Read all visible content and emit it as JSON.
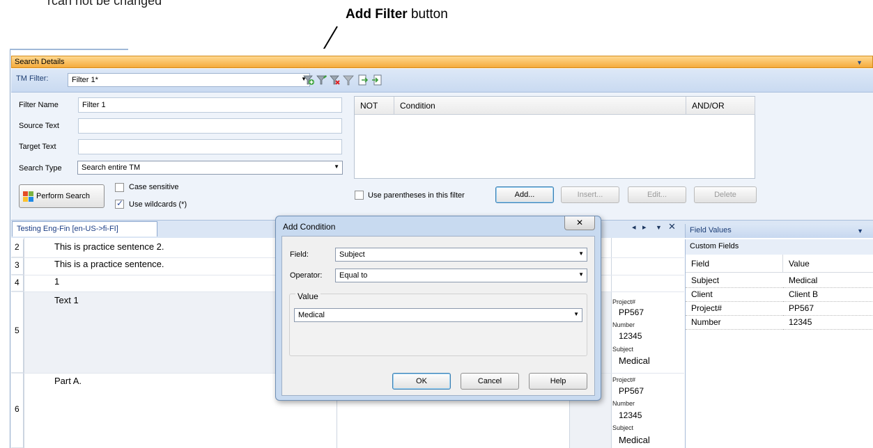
{
  "annotation": {
    "top_text": "rcan not be changed",
    "callout_bold": "Add Filter",
    "callout_rest": " button"
  },
  "app": {
    "panel_title": "Search Details",
    "tm_filter_label": "TM Filter:",
    "tm_filter_value": "Filter 1*",
    "toolbar_icons": [
      "add-filter-icon",
      "edit-filter-icon",
      "delete-filter-icon",
      "clear-filter-icon",
      "export-filter-icon",
      "import-filter-icon"
    ]
  },
  "form": {
    "filter_name_label": "Filter Name",
    "filter_name_value": "Filter 1",
    "source_text_label": "Source Text",
    "source_text_value": "",
    "target_text_label": "Target Text",
    "target_text_value": "",
    "search_type_label": "Search Type",
    "search_type_value": "Search entire TM",
    "perform_search": "Perform Search",
    "case_sensitive": "Case sensitive",
    "case_sensitive_checked": false,
    "use_wildcards": "Use wildcards (*)",
    "use_wildcards_checked": true
  },
  "conditions": {
    "col_not": "NOT",
    "col_condition": "Condition",
    "col_andor": "AND/OR",
    "use_parentheses": "Use parentheses in this filter",
    "add": "Add...",
    "insert": "Insert...",
    "edit": "Edit...",
    "delete": "Delete"
  },
  "doc": {
    "tab_label": "Testing Eng-Fin [en-US->fi-FI]",
    "rows": [
      {
        "num": "2",
        "text": "This is practice sentence 2."
      },
      {
        "num": "3",
        "text": "This is a practice sentence."
      },
      {
        "num": "4",
        "text": "1"
      },
      {
        "num": "5",
        "text": "Text 1"
      },
      {
        "num": "6",
        "text": "Part A."
      }
    ],
    "attrs_row5": {
      "project_label": "Project#",
      "project_value": "PP567",
      "number_label": "Number",
      "number_value": "12345",
      "subject_label": "Subject",
      "subject_value": "Medical"
    },
    "attrs_row6": {
      "project_label": "Project#",
      "project_value": "PP567",
      "number_label": "Number",
      "number_value": "12345",
      "subject_label": "Subject",
      "subject_value": "Medical"
    }
  },
  "field_values": {
    "title": "Field Values",
    "subtitle": "Custom Fields",
    "col_field": "Field",
    "col_value": "Value",
    "rows": [
      {
        "field": "Subject",
        "value": "Medical"
      },
      {
        "field": "Client",
        "value": "Client B"
      },
      {
        "field": "Project#",
        "value": "PP567"
      },
      {
        "field": "Number",
        "value": "12345"
      }
    ]
  },
  "dialog": {
    "title": "Add Condition",
    "field_label": "Field:",
    "field_value": "Subject",
    "operator_label": "Operator:",
    "operator_value": "Equal to",
    "value_group_label": "Value",
    "value_value": "Medical",
    "ok": "OK",
    "cancel": "Cancel",
    "help": "Help"
  }
}
